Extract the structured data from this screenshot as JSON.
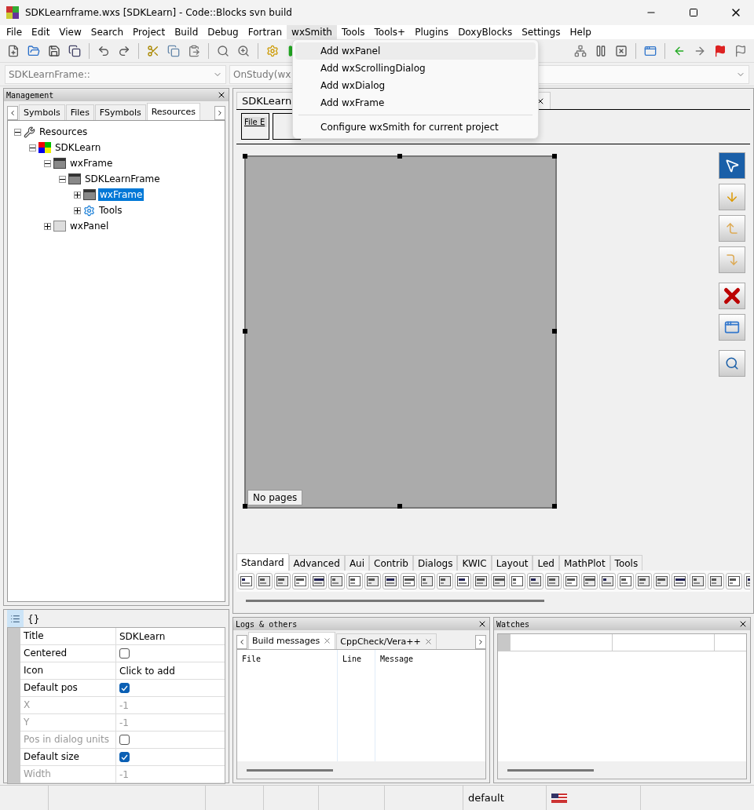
{
  "window": {
    "title": "SDKLearnframe.wxs [SDKLearn] - Code::Blocks svn build"
  },
  "menu_bar": [
    {
      "label": "File",
      "selected": false
    },
    {
      "label": "Edit",
      "selected": false
    },
    {
      "label": "View",
      "selected": false
    },
    {
      "label": "Search",
      "selected": false
    },
    {
      "label": "Project",
      "selected": false
    },
    {
      "label": "Build",
      "selected": false
    },
    {
      "label": "Debug",
      "selected": false
    },
    {
      "label": "Fortran",
      "selected": false
    },
    {
      "label": "wxSmith",
      "selected": true
    },
    {
      "label": "Tools",
      "selected": false
    },
    {
      "label": "Tools+",
      "selected": false
    },
    {
      "label": "Plugins",
      "selected": false
    },
    {
      "label": "DoxyBlocks",
      "selected": false
    },
    {
      "label": "Settings",
      "selected": false
    },
    {
      "label": "Help",
      "selected": false
    }
  ],
  "open_menu": {
    "items": [
      {
        "label": "Add wxPanel",
        "selected": true
      },
      {
        "label": "Add wxScrollingDialog",
        "selected": false
      },
      {
        "label": "Add wxDialog",
        "selected": false
      },
      {
        "label": "Add wxFrame",
        "selected": false
      },
      {
        "label": "Configure wxSmith for current project",
        "selected": false,
        "separator_before": true
      }
    ]
  },
  "code_bar": {
    "scope": "SDKLearnFrame::",
    "function": "OnStudy(wx"
  },
  "management": {
    "title": "Management",
    "tabs": [
      {
        "label": "Symbols",
        "selected": false
      },
      {
        "label": "Files",
        "selected": false
      },
      {
        "label": "FSymbols",
        "selected": false
      },
      {
        "label": "Resources",
        "selected": true
      }
    ],
    "tree": [
      {
        "label": "Resources",
        "kind": "resources",
        "expanded": true,
        "selected": false,
        "children": [
          {
            "label": "SDKLearn",
            "kind": "project",
            "expanded": true,
            "selected": false,
            "children": [
              {
                "label": "wxFrame",
                "kind": "frame",
                "expanded": true,
                "selected": false,
                "children": [
                  {
                    "label": "SDKLearnFrame",
                    "kind": "frame",
                    "expanded": true,
                    "selected": false,
                    "children": [
                      {
                        "label": "wxFrame",
                        "kind": "frame",
                        "expanded": false,
                        "selected": true
                      },
                      {
                        "label": "Tools",
                        "kind": "tools",
                        "expanded": false,
                        "selected": false
                      }
                    ]
                  }
                ]
              },
              {
                "label": "wxPanel",
                "kind": "panel",
                "expanded": false,
                "selected": false
              }
            ]
          }
        ]
      }
    ]
  },
  "properties": {
    "tabs": [
      {
        "kind": "grid",
        "selected": true
      },
      {
        "label": "{}",
        "kind": "text",
        "selected": false
      }
    ],
    "rows": [
      {
        "name": "Title",
        "kind": "text",
        "value": "SDKLearn",
        "disabled": false
      },
      {
        "name": "Centered",
        "kind": "checkbox",
        "checked": false,
        "disabled": false
      },
      {
        "name": "Icon",
        "kind": "text",
        "value": "Click to add",
        "disabled": false
      },
      {
        "name": "Default pos",
        "kind": "checkbox",
        "checked": true,
        "disabled": false
      },
      {
        "name": "X",
        "kind": "text",
        "value": "-1",
        "disabled": true
      },
      {
        "name": "Y",
        "kind": "text",
        "value": "-1",
        "disabled": true
      },
      {
        "name": "Pos in dialog units",
        "kind": "checkbox",
        "checked": false,
        "disabled": true
      },
      {
        "name": "Default size",
        "kind": "checkbox",
        "checked": true,
        "disabled": false
      },
      {
        "name": "Width",
        "kind": "text",
        "value": "-1",
        "disabled": true
      }
    ]
  },
  "editor": {
    "tab": "SDKLearn",
    "preview_menu": "File E",
    "canvas_label": "No pages",
    "palette_tabs": [
      {
        "label": "Standard",
        "selected": true
      },
      {
        "label": "Advanced",
        "selected": false
      },
      {
        "label": "Aui",
        "selected": false
      },
      {
        "label": "Contrib",
        "selected": false
      },
      {
        "label": "Dialogs",
        "selected": false
      },
      {
        "label": "KWIC",
        "selected": false
      },
      {
        "label": "Layout",
        "selected": false
      },
      {
        "label": "Led",
        "selected": false
      },
      {
        "label": "MathPlot",
        "selected": false
      },
      {
        "label": "Tools",
        "selected": false
      }
    ]
  },
  "logs": {
    "title": "Logs & others",
    "tabs": [
      {
        "label": "Build messages",
        "selected": true
      },
      {
        "label": "CppCheck/Vera++",
        "selected": false
      }
    ],
    "columns": [
      "File",
      "Line",
      "Message"
    ]
  },
  "watches": {
    "title": "Watches"
  },
  "status_bar": {
    "profile": "default"
  }
}
